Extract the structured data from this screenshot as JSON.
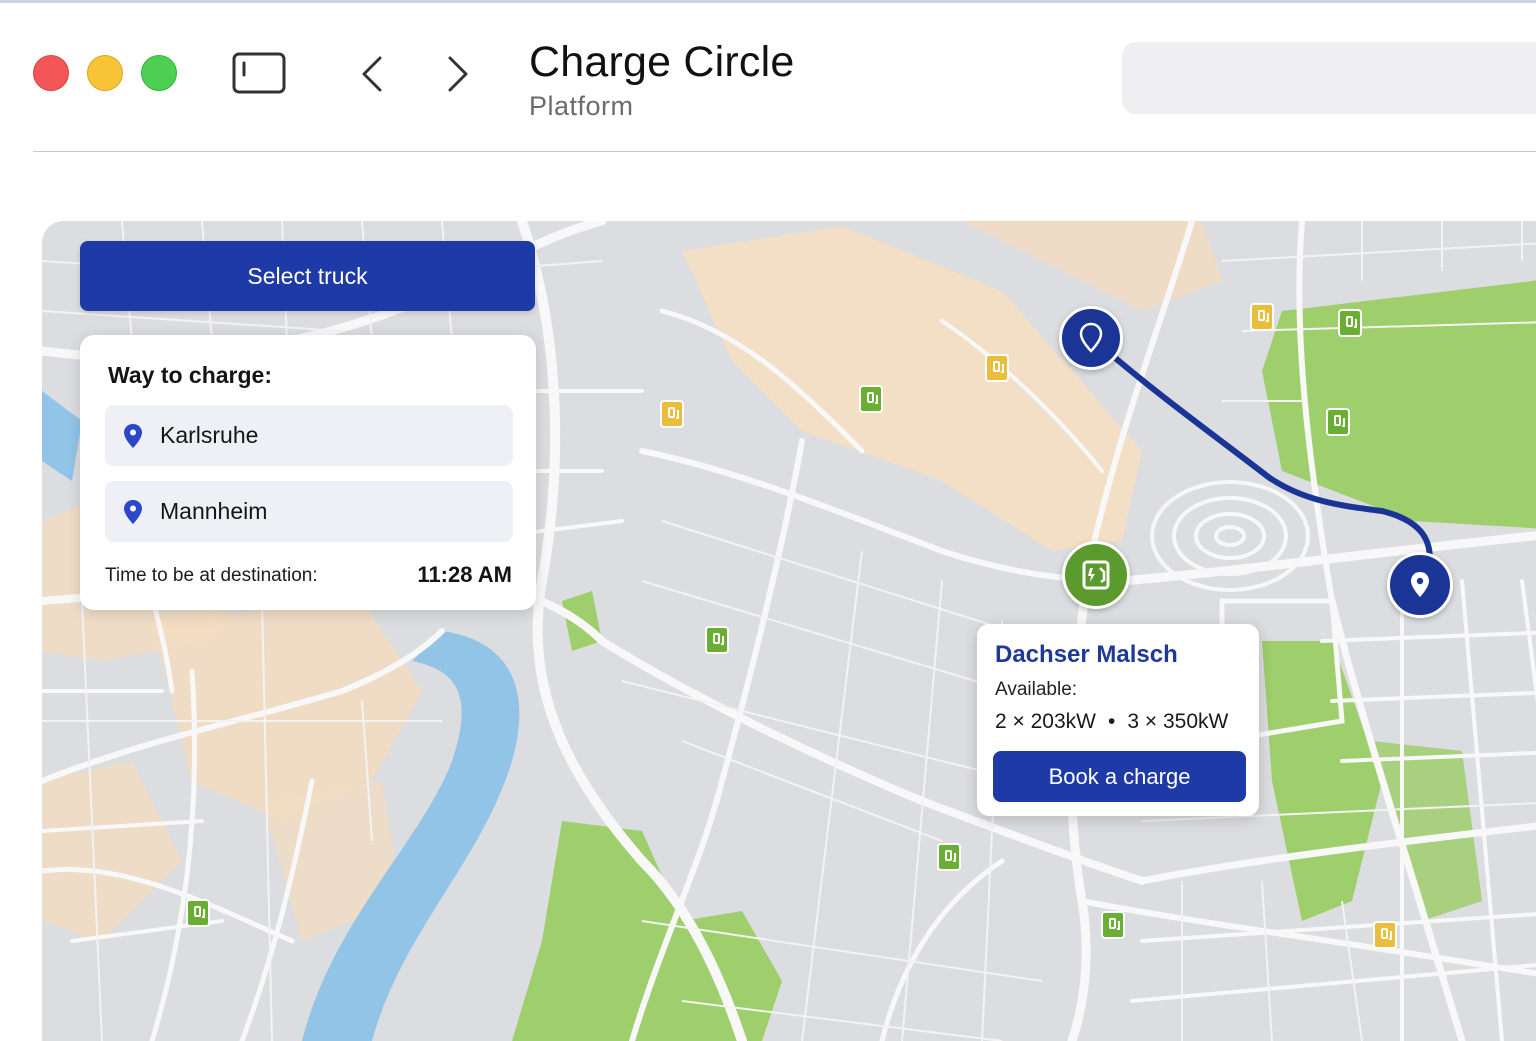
{
  "window": {
    "title": "Charge Circle",
    "subtitle": "Platform",
    "search_placeholder": ""
  },
  "icons": {
    "close": "traffic-light-red",
    "minimize": "traffic-light-yellow",
    "zoom": "traffic-light-green",
    "sidebar": "sidebar-toggle-icon",
    "back": "chevron-left-icon",
    "forward": "chevron-right-icon",
    "location": "map-pin-icon",
    "station": "charging-station-icon"
  },
  "route_panel": {
    "select_truck_label": "Select truck",
    "title": "Way to charge:",
    "origin": "Karlsruhe",
    "destination": "Mannheim",
    "time_label": "Time to be at destination:",
    "time_value": "11:28 AM"
  },
  "station_popup": {
    "name": "Dachser Malsch",
    "available_label": "Available:",
    "capacity_a": "2 × 203kW",
    "separator": "•",
    "capacity_b": "3 × 350kW",
    "book_label": "Book a charge"
  },
  "colors": {
    "primary": "#1e3aa6",
    "route": "#1a3595",
    "station_green": "#5b9a2c",
    "poi_yellow": "#ebbd3c",
    "water": "#92c4e8",
    "park": "#9fce6c",
    "sand": "#f3dcc0"
  }
}
